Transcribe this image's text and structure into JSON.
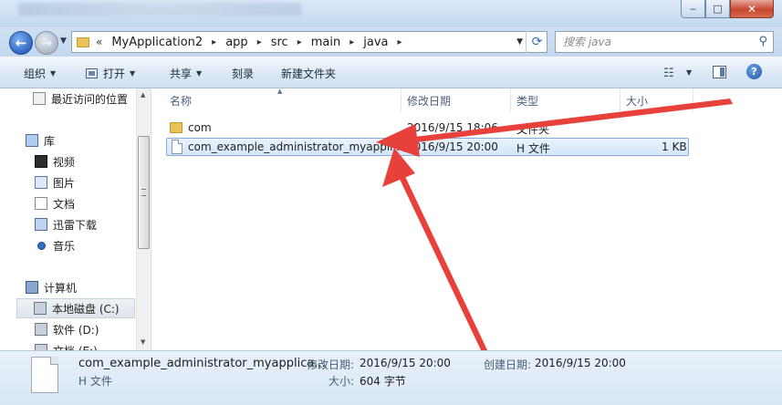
{
  "window": {
    "minimize_label": "‒",
    "maximize_label": "□",
    "close_label": "✕"
  },
  "address": {
    "overflow_chevron": "«",
    "crumbs": [
      "MyApplication2",
      "app",
      "src",
      "main",
      "java"
    ],
    "separator": "▸"
  },
  "search": {
    "placeholder": "搜索 java"
  },
  "toolbar": {
    "organize": "组织",
    "open": "打开",
    "share": "共享",
    "burn": "刻录",
    "new_folder": "新建文件夹"
  },
  "sidebar": {
    "items": [
      {
        "label": "最近访问的位置",
        "icon": "recent-places-icon"
      },
      {
        "label": "库",
        "icon": "library-icon"
      },
      {
        "label": "视频",
        "icon": "video-icon"
      },
      {
        "label": "图片",
        "icon": "pictures-icon"
      },
      {
        "label": "文档",
        "icon": "documents-icon"
      },
      {
        "label": "迅雷下载",
        "icon": "download-icon"
      },
      {
        "label": "音乐",
        "icon": "music-icon"
      },
      {
        "label": "计算机",
        "icon": "computer-icon"
      },
      {
        "label": "本地磁盘 (C:)",
        "icon": "local-disk-icon"
      },
      {
        "label": "软件 (D:)",
        "icon": "drive-icon"
      },
      {
        "label": "文档 (E:)",
        "icon": "drive-icon"
      }
    ]
  },
  "columns": {
    "name": "名称",
    "modified": "修改日期",
    "type": "类型",
    "size": "大小"
  },
  "files": [
    {
      "name": "com",
      "modified": "2016/9/15 18:06",
      "type": "文件夹",
      "size": ""
    },
    {
      "name": "com_example_administrator_myappli...",
      "modified": "2016/9/15 20:00",
      "type": "H 文件",
      "size": "1 KB"
    }
  ],
  "details": {
    "name": "com_example_administrator_myapplica...",
    "type": "H 文件",
    "modified_label": "修改日期:",
    "modified_value": "2016/9/15 20:00",
    "size_label": "大小:",
    "size_value": "604 字节",
    "created_label": "创建日期:",
    "created_value": "2016/9/15 20:00"
  },
  "annotation_color": "#e8403a"
}
